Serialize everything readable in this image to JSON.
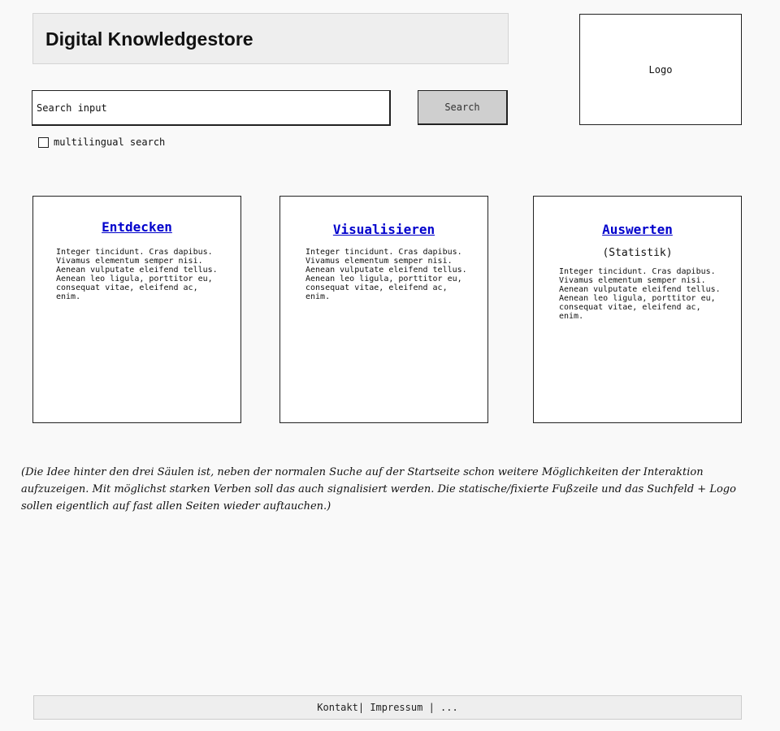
{
  "header": {
    "title": "Digital Knowledgestore"
  },
  "logo": {
    "label": "Logo"
  },
  "search": {
    "placeholder": "Search input",
    "button_label": "Search",
    "multilingual_label": "multilingual search",
    "multilingual_checked": false
  },
  "cards": [
    {
      "title": "Entdecken",
      "subtitle": "",
      "body": "Integer tincidunt. Cras dapibus.\nVivamus elementum semper nisi.\nAenean vulputate eleifend tellus.\nAenean leo ligula, porttitor eu,\nconsequat vitae, eleifend ac,\nenim."
    },
    {
      "title": "Visualisieren",
      "subtitle": "",
      "body": "Integer tincidunt. Cras dapibus.\nVivamus elementum semper nisi.\nAenean vulputate eleifend tellus.\nAenean leo ligula, porttitor eu,\nconsequat vitae, eleifend ac,\nenim."
    },
    {
      "title": "Auswerten",
      "subtitle": "(Statistik)",
      "body": "Integer tincidunt. Cras dapibus.\nVivamus elementum semper nisi.\nAenean vulputate eleifend tellus.\nAenean leo ligula, porttitor eu,\nconsequat vitae, eleifend ac,\nenim."
    }
  ],
  "note": "(Die Idee hinter den drei Säulen ist, neben der normalen Suche auf der Startseite schon weitere Möglichkeiten der Interaktion aufzuzeigen. Mit möglichst starken Verben soll das auch signalisiert werden. Die statische/fixierte Fußzeile und das Suchfeld + Logo sollen eigentlich auf fast allen Seiten wieder auftauchen.)",
  "footer": {
    "kontakt": "Kontakt",
    "sep1": "| ",
    "impressum": "Impressum",
    "sep2": " | ",
    "more": "..."
  }
}
